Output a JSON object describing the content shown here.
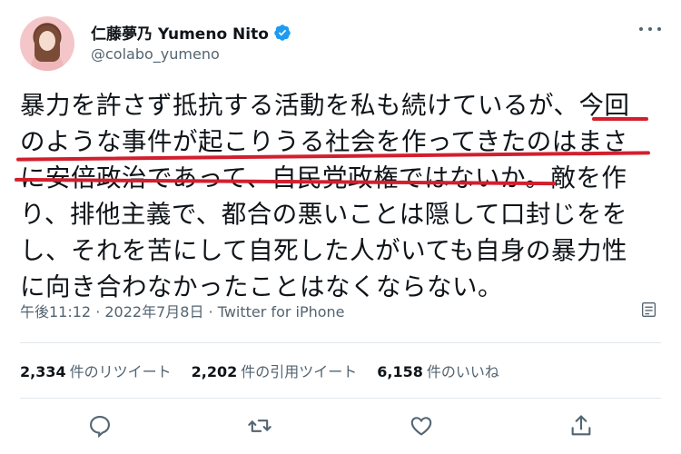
{
  "user": {
    "display_name": "仁藤夢乃 Yumeno Nito",
    "handle": "@colabo_yumeno"
  },
  "tweet": {
    "lines": [
      "暴力を許さず抵抗する活動を私も続けているが、今回",
      "のような事件が起こりうる社会を作ってきたのはまさ",
      "に安倍政治であって、自民党政権ではないか。敵を作",
      "り、排他主義で、都合の悪いことは隠して口封じをを",
      "し、それを苦にして自死した人がいても自身の暴力性",
      "に向き合わなかったことはなくならない。"
    ]
  },
  "meta": {
    "time_date": "午後11:12 · 2022年7月8日",
    "separator": " · ",
    "source": "Twitter for iPhone"
  },
  "stats": {
    "retweets_count": "2,334",
    "retweets_label": "件のリツイート",
    "quotes_count": "2,202",
    "quotes_label": "件の引用ツイート",
    "likes_count": "6,158",
    "likes_label": "件のいいね"
  },
  "colors": {
    "verified": "#1d9bf0",
    "underline": "#d21f2e",
    "secondary_text": "#536471"
  },
  "icons": [
    "verified-badge-icon",
    "more-icon",
    "analytics-icon",
    "reply-icon",
    "retweet-icon",
    "like-icon",
    "share-icon"
  ]
}
